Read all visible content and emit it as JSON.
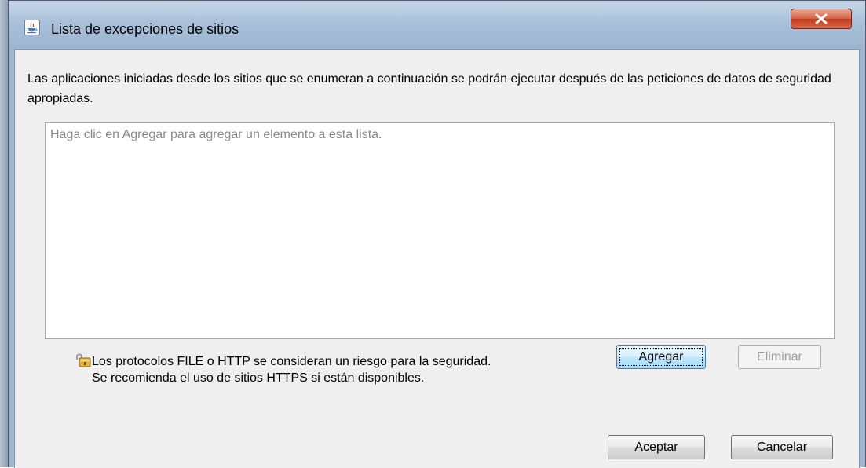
{
  "window": {
    "title": "Lista de excepciones de sitios",
    "title_icon": "java-cup-icon",
    "close_icon": "close-icon",
    "close_color": "#c74a2c"
  },
  "dialog": {
    "description": "Las aplicaciones iniciadas desde los sitios que se enumeran a continuación se podrán ejecutar después de las peticiones de datos de seguridad apropiadas.",
    "list_placeholder": "Haga clic en Agregar para agregar un elemento a esta lista.",
    "list_items": [],
    "add_label": "Agregar",
    "remove_label": "Eliminar",
    "warning_icon": "lock-icon",
    "warning_line1": "Los protocolos FILE o HTTP se consideran un riesgo para la seguridad.",
    "warning_line2": "Se recomienda el uso de sitios HTTPS si están disponibles.",
    "ok_label": "Aceptar",
    "cancel_label": "Cancelar"
  }
}
